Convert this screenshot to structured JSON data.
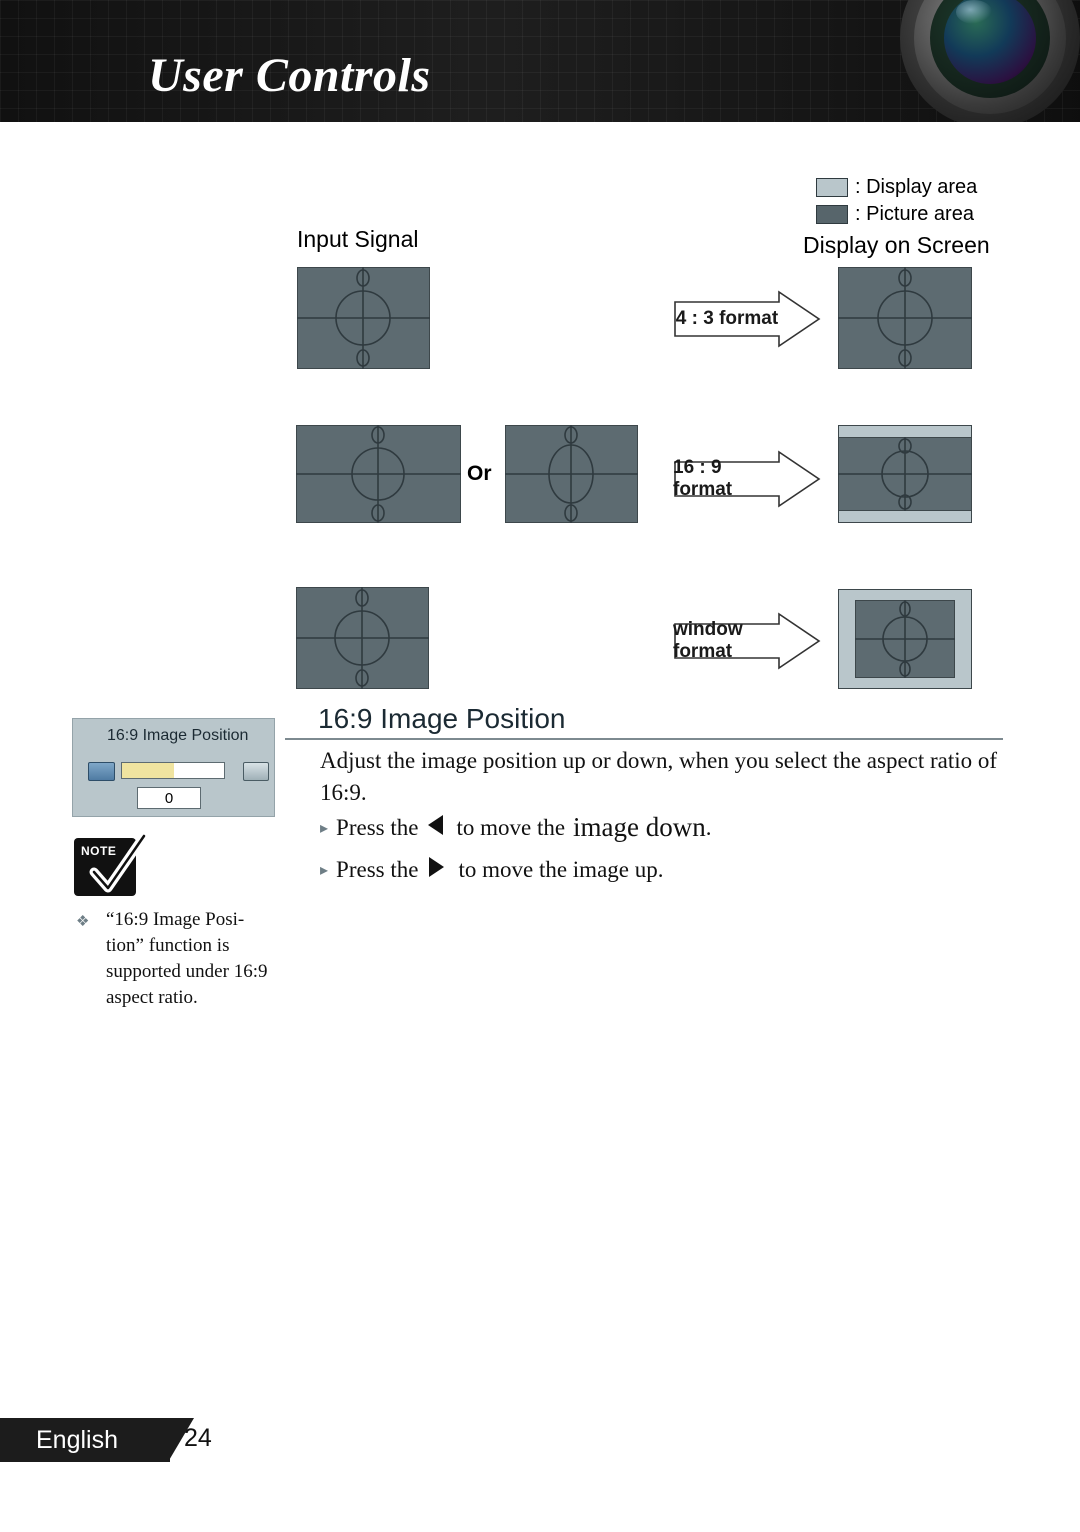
{
  "header": {
    "title": "User Controls",
    "lens_icon": "camera-lens-icon"
  },
  "legend": {
    "items": [
      {
        "swatch": "display-area-swatch",
        "label": ": Display area"
      },
      {
        "swatch": "picture-area-swatch",
        "label": ": Picture area"
      }
    ]
  },
  "diagram": {
    "input_label": "Input Signal",
    "screen_label": "Display on Screen",
    "or_label": "Or",
    "rows": [
      {
        "arrow_label": "4 : 3 format"
      },
      {
        "arrow_label": "16 : 9 format"
      },
      {
        "arrow_label": "window format"
      }
    ]
  },
  "osd": {
    "title": "16:9 Image Position",
    "value": "0",
    "left_icon": "screen-down-icon",
    "right_icon": "screen-up-icon"
  },
  "note": {
    "icon_label": "NOTE",
    "bullet": "❖",
    "text": "“16:9 Image Posi-tion” function is supported under 16:9 aspect ratio."
  },
  "section": {
    "title": "16:9 Image Position",
    "paragraph": "Adjust the image position up or down, when you select the aspect ratio of 16:9.",
    "bullets": [
      {
        "marker": "▸",
        "pre": "Press the",
        "key": "left-arrow-key",
        "post_normal": "to move the",
        "post_emphasis": "image down",
        "tail": "."
      },
      {
        "marker": "▸",
        "pre": "Press the",
        "key": "right-arrow-key",
        "post_normal": "to move the image up",
        "post_emphasis": "",
        "tail": "."
      }
    ]
  },
  "footer": {
    "language": "English",
    "page": "24"
  },
  "colors": {
    "header_bg": "#1c1c1c",
    "picture_area": "#5d6b71",
    "display_area": "#b9c6cb",
    "rule": "#7d8a90",
    "osd_fill": "#f0e4a0"
  }
}
